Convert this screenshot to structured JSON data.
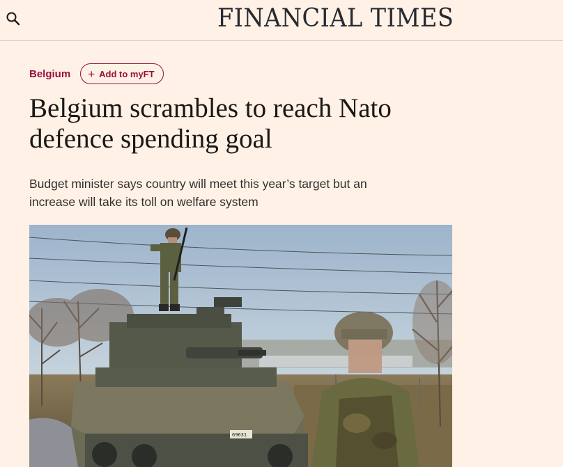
{
  "header": {
    "masthead": "FINANCIAL TIMES",
    "search_icon": "search-icon"
  },
  "article": {
    "topic": "Belgium",
    "add_to_myft": "Add to myFT",
    "headline_line1": "Belgium scrambles to reach Nato",
    "headline_line2": "defence spending goal",
    "standfirst_line1": "Budget minister says country will meet this year’s target but an",
    "standfirst_line2": "increase will take its toll on welfare system",
    "image_plate": "69631"
  },
  "colors": {
    "background": "#fff1e5",
    "accent": "#990f3d",
    "text": "#33302e"
  }
}
